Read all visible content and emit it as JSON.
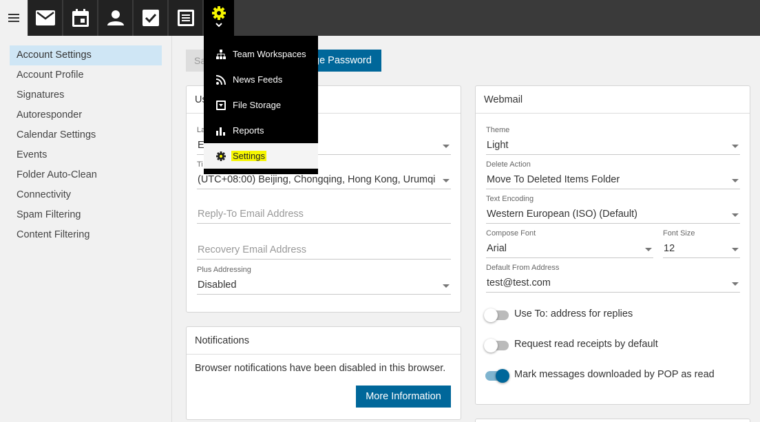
{
  "topbar": {
    "icons": [
      "menu-icon",
      "mail-icon",
      "calendar-icon",
      "contacts-icon",
      "tasks-icon",
      "notes-icon",
      "settings-gear-icon"
    ],
    "accent_active": "#f5f500"
  },
  "sidebar": {
    "items": [
      {
        "label": "Account Settings"
      },
      {
        "label": "Account Profile"
      },
      {
        "label": "Signatures"
      },
      {
        "label": "Autoresponder"
      },
      {
        "label": "Calendar Settings"
      },
      {
        "label": "Events"
      },
      {
        "label": "Folder Auto-Clean"
      },
      {
        "label": "Connectivity"
      },
      {
        "label": "Spam Filtering"
      },
      {
        "label": "Content Filtering"
      }
    ]
  },
  "actions": {
    "save_label": "Sa",
    "change_password_label": "ge Password"
  },
  "user_card": {
    "title": "Us",
    "language_label": "La",
    "language_value": "E",
    "timezone_label": "Ti",
    "timezone_value": "(UTC+08:00) Beijing, Chongqing, Hong Kong, Urumqi",
    "reply_to_placeholder": "Reply-To Email Address",
    "recovery_placeholder": "Recovery Email Address",
    "plus_addressing_label": "Plus Addressing",
    "plus_addressing_value": "Disabled"
  },
  "notifications_card": {
    "title": "Notifications",
    "text": "Browser notifications have been disabled in this browser.",
    "button": "More Information"
  },
  "webmail_card": {
    "title": "Webmail",
    "theme_label": "Theme",
    "theme_value": "Light",
    "delete_action_label": "Delete Action",
    "delete_action_value": "Move To Deleted Items Folder",
    "text_encoding_label": "Text Encoding",
    "text_encoding_value": "Western European (ISO) (Default)",
    "compose_font_label": "Compose Font",
    "compose_font_value": "Arial",
    "font_size_label": "Font Size",
    "font_size_value": "12",
    "default_from_label": "Default From Address",
    "default_from_value": "test@test.com",
    "toggles": [
      {
        "label": "Use To: address for replies",
        "on": false
      },
      {
        "label": "Request read receipts by default",
        "on": false
      },
      {
        "label": "Mark messages downloaded by POP as read",
        "on": true
      }
    ]
  },
  "dropdown_menu": {
    "items": [
      {
        "label": "Team Workspaces",
        "icon": "sitemap-icon"
      },
      {
        "label": "News Feeds",
        "icon": "rss-icon"
      },
      {
        "label": "File Storage",
        "icon": "storage-icon"
      },
      {
        "label": "Reports",
        "icon": "bar-chart-icon"
      },
      {
        "label": "Settings",
        "icon": "gear-icon"
      }
    ]
  }
}
